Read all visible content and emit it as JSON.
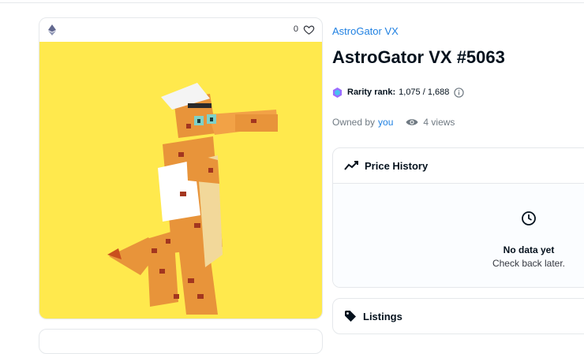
{
  "colors": {
    "accent_link": "#2081e2",
    "media_background": "#ffe94d",
    "title": "#04111d",
    "muted": "#707a83"
  },
  "media": {
    "favorite_count": "0",
    "chain_icon": "ethereum-icon",
    "favorite_icon": "heart-icon"
  },
  "item": {
    "collection_name": "AstroGator VX",
    "title": "AstroGator VX #5063"
  },
  "rarity": {
    "label": "Rarity rank:",
    "value": "1,075 / 1,688",
    "icon": "rarity-icon",
    "info_icon": "info-icon"
  },
  "ownership": {
    "owned_by_label": "Owned by",
    "owner": "you",
    "views": "4 views",
    "views_icon": "eye-icon"
  },
  "price_history": {
    "title": "Price History",
    "icon": "chart-line-icon",
    "empty_title": "No data yet",
    "empty_subtitle": "Check back later."
  },
  "listings": {
    "title": "Listings",
    "icon": "tag-icon"
  }
}
